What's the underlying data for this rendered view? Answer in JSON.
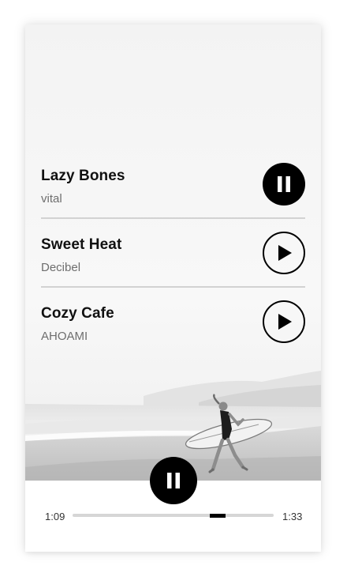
{
  "player": {
    "tracks": [
      {
        "title": "Lazy Bones",
        "artist": "vital",
        "state": "playing",
        "control_icon": "pause-icon"
      },
      {
        "title": "Sweet Heat",
        "artist": "Decibel",
        "state": "paused",
        "control_icon": "play-icon"
      },
      {
        "title": "Cozy Cafe",
        "artist": "AHOAMI",
        "state": "paused",
        "control_icon": "play-icon"
      }
    ],
    "main_control_icon": "pause-icon",
    "elapsed": "1:09",
    "total": "1:33",
    "progress_fraction": 0.742
  },
  "colors": {
    "accent": "#000000",
    "divider": "#d2d2d2",
    "artist_text": "#6e6e6e",
    "track_bar": "#d6d6d6"
  },
  "hero_image": "black-and-white photo of a surfer walking on the beach carrying a surfboard"
}
